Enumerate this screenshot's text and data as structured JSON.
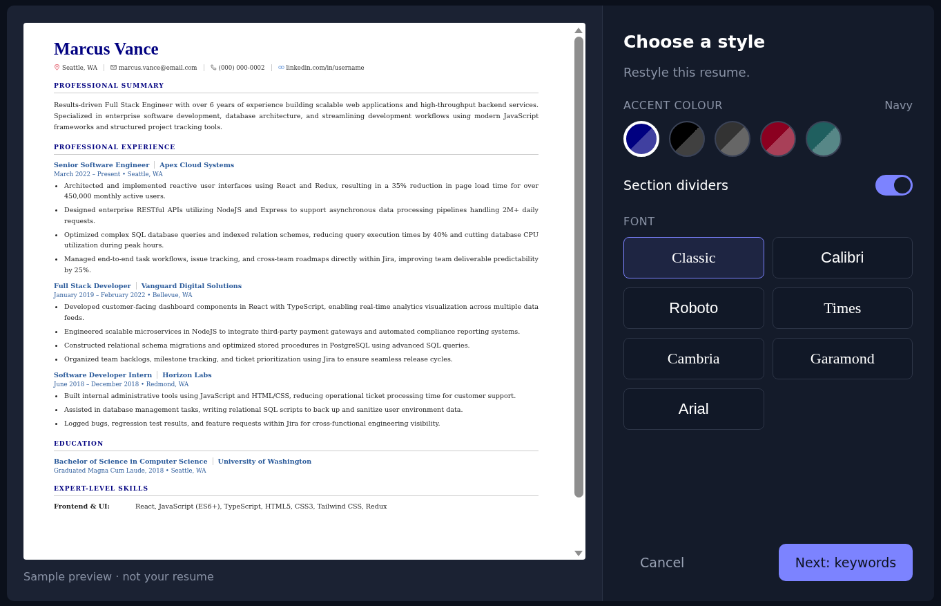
{
  "resume": {
    "name": "Marcus Vance",
    "contact": [
      {
        "kind": "location",
        "text": "Seattle, WA"
      },
      {
        "kind": "email",
        "text": "marcus.vance@email.com"
      },
      {
        "kind": "phone",
        "text": "(000) 000-0002"
      },
      {
        "kind": "link",
        "text": "linkedin.com/in/username"
      }
    ],
    "sections": [
      {
        "kind": "paragraph",
        "heading": "PROFESSIONAL SUMMARY",
        "text": "Results-driven Full Stack Engineer with over 6 years of experience building scalable web applications and high-throughput backend services. Specialized in enterprise software development, database architecture, and streamlining development workflows using modern JavaScript frameworks and structured project tracking tools."
      },
      {
        "kind": "entries",
        "heading": "PROFESSIONAL EXPERIENCE",
        "entries": [
          {
            "title": "Senior Software Engineer",
            "org": "Apex Cloud Systems",
            "meta": "March 2022 – Present • Seattle, WA",
            "bullets": [
              "Architected and implemented reactive user interfaces using React and Redux, resulting in a 35% reduction in page load time for over 450,000 monthly active users.",
              "Designed enterprise RESTful APIs utilizing NodeJS and Express to support asynchronous data processing pipelines handling 2M+ daily requests.",
              "Optimized complex SQL database queries and indexed relation schemes, reducing query execution times by 40% and cutting database CPU utilization during peak hours.",
              "Managed end-to-end task workflows, issue tracking, and cross-team roadmaps directly within Jira, improving team deliverable predictability by 25%."
            ]
          },
          {
            "title": "Full Stack Developer",
            "org": "Vanguard Digital Solutions",
            "meta": "January 2019 – February 2022 • Bellevue, WA",
            "bullets": [
              "Developed customer-facing dashboard components in React with TypeScript, enabling real-time analytics visualization across multiple data feeds.",
              "Engineered scalable microservices in NodeJS to integrate third-party payment gateways and automated compliance reporting systems.",
              "Constructed relational schema migrations and optimized stored procedures in PostgreSQL using advanced SQL queries.",
              "Organized team backlogs, milestone tracking, and ticket prioritization using Jira to ensure seamless release cycles."
            ]
          },
          {
            "title": "Software Developer Intern",
            "org": "Horizon Labs",
            "meta": "June 2018 – December 2018 • Redmond, WA",
            "bullets": [
              "Built internal administrative tools using JavaScript and HTML/CSS, reducing operational ticket processing time for customer support.",
              "Assisted in database management tasks, writing relational SQL scripts to back up and sanitize user environment data.",
              "Logged bugs, regression test results, and feature requests within Jira for cross-functional engineering visibility."
            ]
          }
        ]
      },
      {
        "kind": "entries",
        "heading": "EDUCATION",
        "entries": [
          {
            "title": "Bachelor of Science in Computer Science",
            "org": "University of Washington",
            "meta": "Graduated Magna Cum Laude, 2018 • Seattle, WA"
          }
        ]
      },
      {
        "kind": "skills",
        "heading": "EXPERT-LEVEL SKILLS",
        "rows": [
          {
            "label": "Frontend & UI:",
            "value": "React, JavaScript (ES6+), TypeScript, HTML5, CSS3, Tailwind CSS, Redux"
          }
        ]
      }
    ]
  },
  "preview_caption": "Sample preview · not your resume",
  "panel": {
    "title": "Choose a style",
    "subtitle": "Restyle this resume.",
    "accent": {
      "label": "ACCENT COLOUR",
      "value": "Navy",
      "swatches": [
        {
          "color": "#000080",
          "selected": true
        },
        {
          "color": "#000000",
          "selected": false
        },
        {
          "color": "#333333",
          "selected": false
        },
        {
          "color": "#8b0020",
          "selected": false
        },
        {
          "color": "#1f5f5f",
          "selected": false
        }
      ]
    },
    "section_dividers": {
      "label": "Section dividers",
      "on": true
    },
    "font": {
      "label": "FONT",
      "options": [
        {
          "label": "Classic",
          "kind": "serif",
          "selected": true
        },
        {
          "label": "Calibri",
          "kind": "sans",
          "selected": false
        },
        {
          "label": "Roboto",
          "kind": "sans",
          "selected": false
        },
        {
          "label": "Times",
          "kind": "serif",
          "selected": false
        },
        {
          "label": "Cambria",
          "kind": "serif",
          "selected": false
        },
        {
          "label": "Garamond",
          "kind": "serif",
          "selected": false
        },
        {
          "label": "Arial",
          "kind": "sans",
          "selected": false
        }
      ]
    },
    "buttons": [
      {
        "kind": "secondary",
        "label": "Cancel"
      },
      {
        "kind": "primary",
        "label": "Next: keywords"
      }
    ]
  }
}
